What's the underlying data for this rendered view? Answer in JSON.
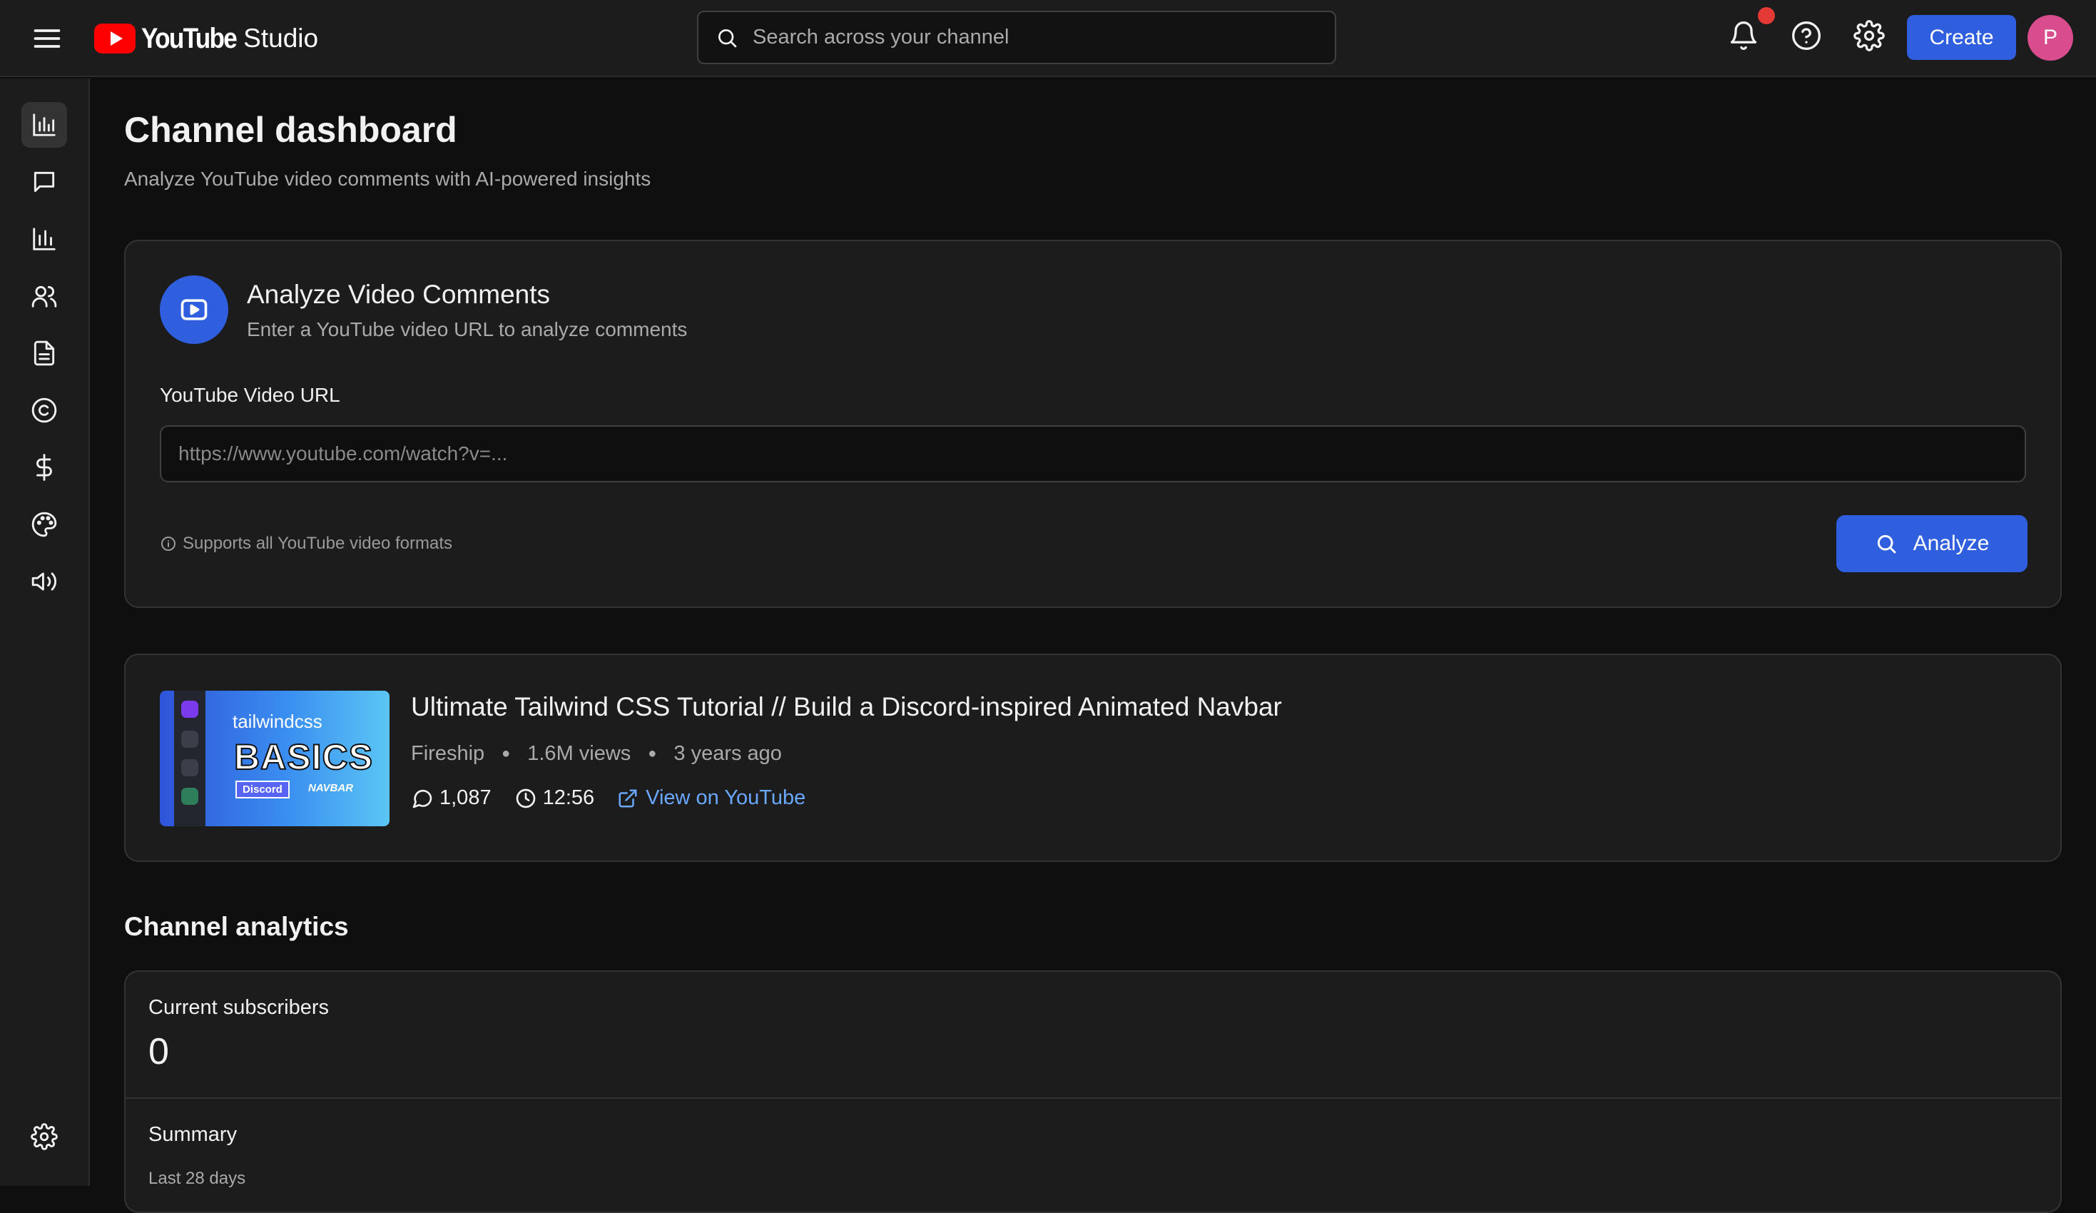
{
  "header": {
    "brand_wordmark": "YouTube",
    "brand_suffix": "Studio",
    "search_placeholder": "Search across your channel",
    "create_label": "Create",
    "avatar_initial": "P",
    "colors": {
      "accent": "#2f5fdf",
      "notification": "#e53935",
      "avatar": "#d94c8e"
    }
  },
  "sidebar": {
    "items": [
      {
        "icon": "dashboard-icon",
        "active": true
      },
      {
        "icon": "comments-icon"
      },
      {
        "icon": "analytics-icon"
      },
      {
        "icon": "community-icon"
      },
      {
        "icon": "subtitles-icon"
      },
      {
        "icon": "copyright-icon"
      },
      {
        "icon": "earn-icon"
      },
      {
        "icon": "customization-icon"
      },
      {
        "icon": "audio-library-icon"
      }
    ],
    "footer_icon": "settings-icon"
  },
  "page": {
    "title": "Channel dashboard",
    "subtitle": "Analyze YouTube video comments with AI-powered insights"
  },
  "analyze": {
    "title": "Analyze Video Comments",
    "subtitle": "Enter a YouTube video URL to analyze comments",
    "url_label": "YouTube Video URL",
    "url_placeholder": "https://www.youtube.com/watch?v=...",
    "url_value": "",
    "hint": "Supports all YouTube video formats",
    "button_label": "Analyze"
  },
  "video": {
    "thumbnail": {
      "brand": "tailwindcss",
      "headline": "BASICS",
      "tag_left": "Discord",
      "tag_right": "NAVBAR"
    },
    "title": "Ultimate Tailwind CSS Tutorial // Build a Discord-inspired Animated Navbar",
    "channel": "Fireship",
    "views": "1.6M views",
    "age": "3 years ago",
    "comments": "1,087",
    "duration": "12:56",
    "link_label": "View on YouTube"
  },
  "analytics": {
    "section_title": "Channel analytics",
    "subscribers_label": "Current subscribers",
    "subscribers_value": "0",
    "summary_label": "Summary",
    "summary_range": "Last 28 days"
  }
}
